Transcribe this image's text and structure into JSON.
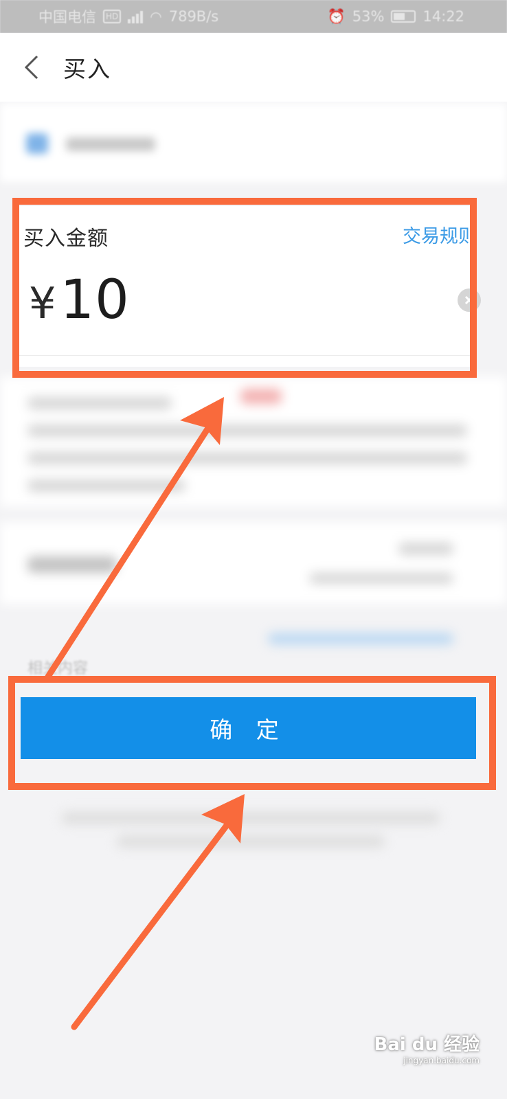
{
  "status_bar": {
    "carrier": "中国电信",
    "badge": "HD",
    "network": "4G",
    "speed": "789B/s",
    "battery": "53%",
    "time": "14:22"
  },
  "header": {
    "title": "买入"
  },
  "amount": {
    "label": "买入金额",
    "rules_link": "交易规则",
    "currency": "¥",
    "value": "10"
  },
  "blurred_hint": "相关内容",
  "confirm_button": "确 定",
  "watermark": {
    "brand": "Bai du 经验",
    "url": "jingyan.baidu.com"
  },
  "colors": {
    "accent": "#138fe8",
    "annotation": "#f96a3c",
    "link": "#3c9be6"
  }
}
